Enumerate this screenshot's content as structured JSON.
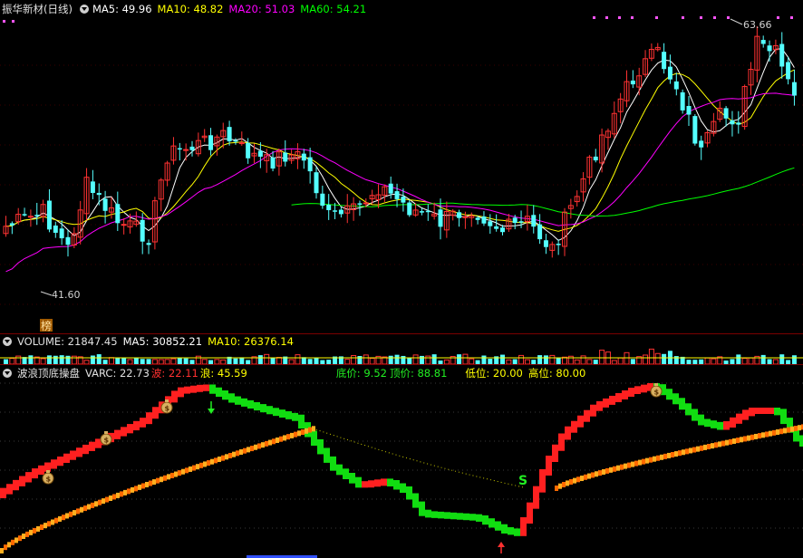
{
  "main": {
    "title": "振华新材(日线)",
    "ma5": "MA5: 49.96",
    "ma10": "MA10: 48.82",
    "ma20": "MA20: 51.03",
    "ma60": "MA60: 54.21",
    "high_label": "63.66",
    "low_label": "41.60",
    "badge": "榜"
  },
  "volume": {
    "label": "VOLUME: 21847.45",
    "ma5": "MA5: 30852.21",
    "ma10": "MA10: 26376.14"
  },
  "indicator": {
    "name": "波浪顶底操盘",
    "varc": "VARC: 22.73",
    "wave1": "波: 22.11",
    "wave2": "浪: 45.59",
    "bottom_price": "底价: 9.52",
    "top_price": "顶价: 88.81",
    "low_level": "低位: 20.00",
    "high_level": "高位: 80.00",
    "signal_s": "S"
  },
  "colors": {
    "up": "#ff3232",
    "down": "#54ffff",
    "ma5": "#ffffff",
    "ma10": "#ffff00",
    "ma20": "#ff00ff",
    "ma60": "#00ff00",
    "wave_up": "#ff2020",
    "wave_down": "#11dd11",
    "orange": "#ff8c00"
  }
}
